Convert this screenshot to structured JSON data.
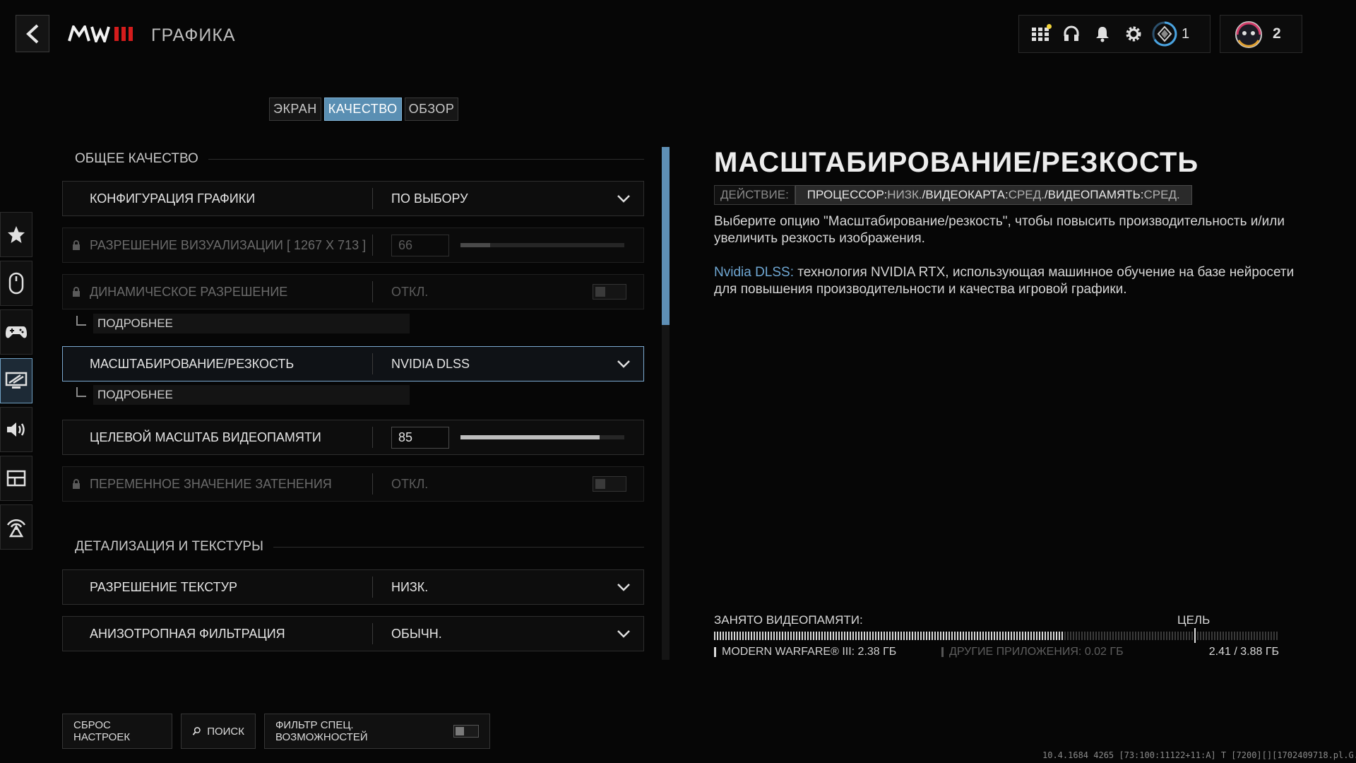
{
  "header": {
    "page_title": "ГРАФИКА",
    "level": "1",
    "profile_count": "2"
  },
  "tabs": [
    "ЭКРАН",
    "КАЧЕСТВО",
    "ОБЗОР"
  ],
  "active_tab": "КАЧЕСТВО",
  "sidebar": {
    "items": [
      "star-icon",
      "mouse-icon",
      "gamepad-icon",
      "graphics-icon",
      "audio-icon",
      "interface-icon",
      "network-icon"
    ],
    "active": "graphics-icon"
  },
  "sections": {
    "general": {
      "title": "ОБЩЕЕ КАЧЕСТВО",
      "config": {
        "label": "КОНФИГУРАЦИЯ ГРАФИКИ",
        "value": "ПО ВЫБОРУ"
      },
      "render_res": {
        "label": "РАЗРЕШЕНИЕ ВИЗУАЛИЗАЦИИ [ 1267 X 713 ]",
        "value": "66",
        "fill_fraction": 0.18,
        "locked": true
      },
      "dynamic_res": {
        "label": "ДИНАМИЧЕСКОЕ РАЗРЕШЕНИЕ",
        "value": "ОТКЛ.",
        "locked": true
      },
      "dynamic_res_more": "ПОДРОБНЕЕ",
      "upscaling": {
        "label": "МАСШТАБИРОВАНИЕ/РЕЗКОСТЬ",
        "value": "NVIDIA DLSS"
      },
      "upscaling_more": "ПОДРОБНЕЕ",
      "vram_target": {
        "label": "ЦЕЛЕВОЙ МАСШТАБ ВИДЕОПАМЯТИ",
        "value": "85",
        "fill_fraction": 0.85
      },
      "vrs": {
        "label": "ПЕРЕМЕННОЕ ЗНАЧЕНИЕ ЗАТЕНЕНИЯ",
        "value": "ОТКЛ.",
        "locked": true
      }
    },
    "details": {
      "title": "ДЕТАЛИЗАЦИЯ И ТЕКСТУРЫ",
      "texture_res": {
        "label": "РАЗРЕШЕНИЕ ТЕКСТУР",
        "value": "НИЗК."
      },
      "aniso": {
        "label": "АНИЗОТРОПНАЯ ФИЛЬТРАЦИЯ",
        "value": "ОБЫЧН."
      }
    }
  },
  "detail_panel": {
    "title": "МАСШТАБИРОВАНИЕ/РЕЗКОСТЬ",
    "impact_label": "ДЕЙСТВИЕ:",
    "cpu_label": "ПРОЦЕССОР:",
    "cpu_value": "НИЗК.",
    "gpu_label": "ВИДЕОКАРТА:",
    "gpu_value": "СРЕД.",
    "vram_label": "ВИДЕОПАМЯТЬ:",
    "vram_value": "СРЕД.",
    "separator": "/",
    "description": "Выберите опцию \"Масштабирование/резкость\", чтобы повысить производительность и/или увеличить резкость изображения.",
    "dlss_name": "Nvidia DLSS:",
    "dlss_text": " технология NVIDIA RTX, использующая машинное обучение на базе нейросети для повышения производительности и качества игровой графики."
  },
  "vram": {
    "label": "ЗАНЯТО ВИДЕОПАМЯТИ:",
    "target_label": "ЦЕЛЬ",
    "game_usage": "MODERN WARFARE® III: 2.38 ГБ",
    "other_usage": "ДРУГИЕ ПРИЛОЖЕНИЯ: 0.02 ГБ",
    "total": "2.41 / 3.88 ГБ",
    "used_fraction": 0.62,
    "target_fraction": 0.85
  },
  "bottom": {
    "reset": "СБРОС НАСТРОЕК",
    "search": "ПОИСК",
    "accessibility_filter": "ФИЛЬТР СПЕЦ. ВОЗМОЖНОСТЕЙ"
  },
  "build_info": "10.4.1684 4265 [73:100:11122+11:A] T [7200][][1702409718.pl.G.steam]",
  "colors": {
    "accent": "#5a8fb3",
    "link": "#6fa7d3",
    "notification": "#f2d43b"
  }
}
